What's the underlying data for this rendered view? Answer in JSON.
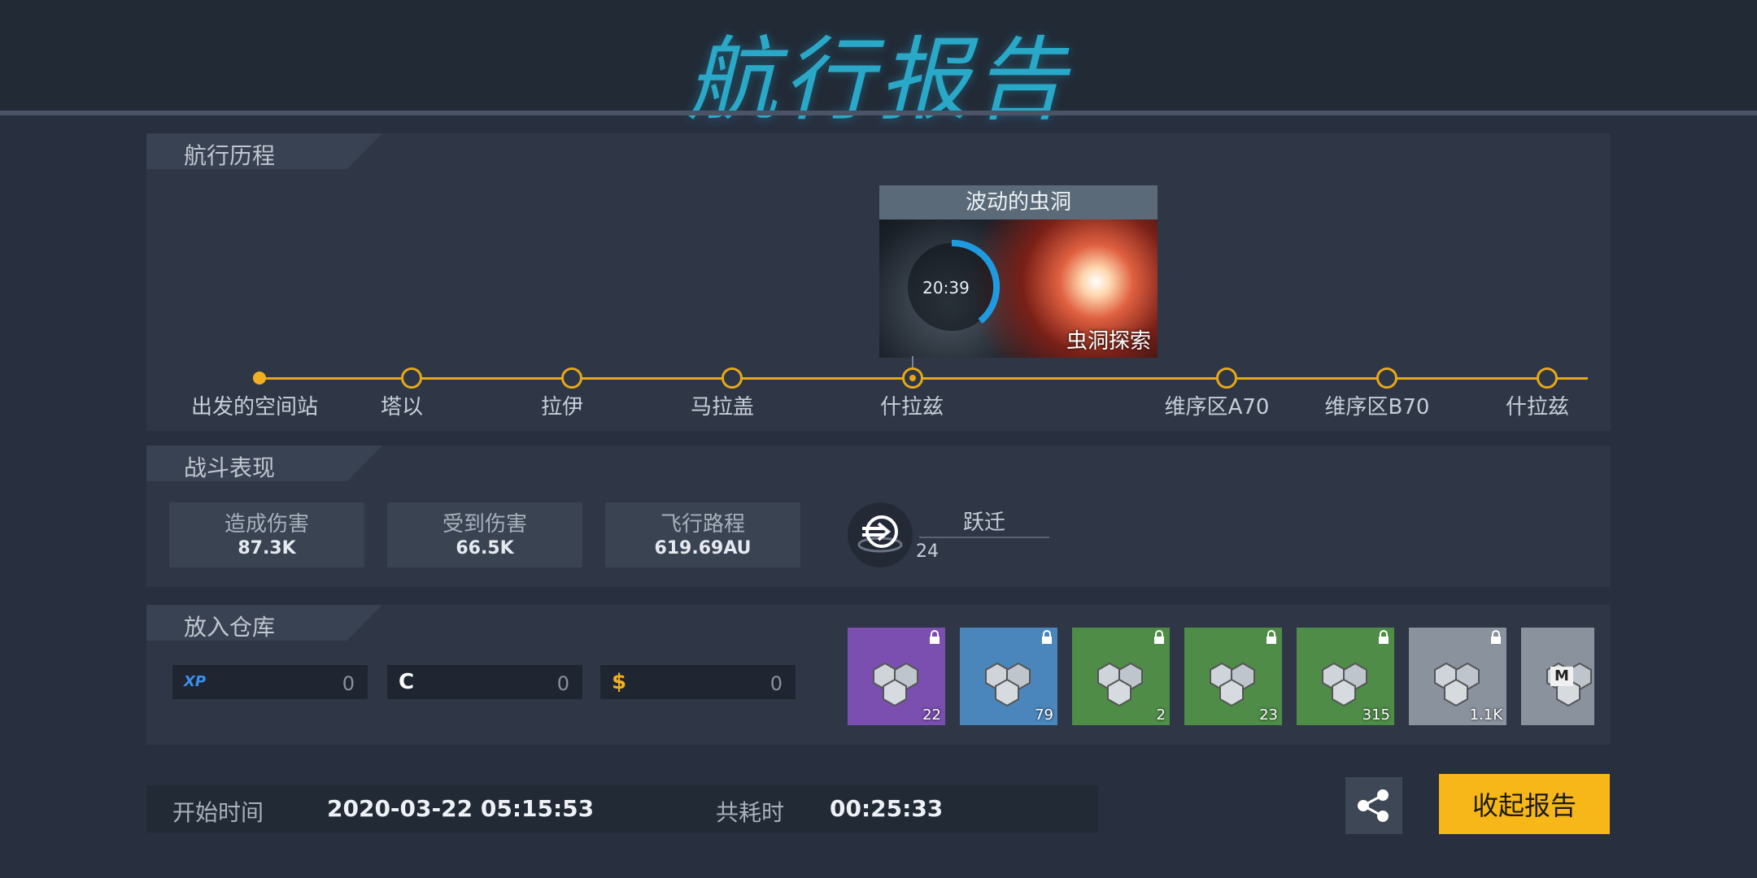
{
  "header": {
    "title": "航行报告"
  },
  "voyage": {
    "section_title": "航行历程",
    "nodes": [
      {
        "label": "出发的空间站"
      },
      {
        "label": "塔以"
      },
      {
        "label": "拉伊"
      },
      {
        "label": "马拉盖"
      },
      {
        "label": "什拉兹"
      },
      {
        "label": "维序区A70"
      },
      {
        "label": "维序区B70"
      },
      {
        "label": "什拉兹"
      }
    ],
    "event": {
      "title": "波动的虫洞",
      "timer": "20:39",
      "subtitle": "虫洞探索"
    }
  },
  "combat": {
    "section_title": "战斗表现",
    "stats": [
      {
        "label": "造成伤害",
        "value": "87.3K"
      },
      {
        "label": "受到伤害",
        "value": "66.5K"
      },
      {
        "label": "飞行路程",
        "value": "619.69AU"
      }
    ],
    "jump": {
      "label": "跃迁",
      "value": "24"
    }
  },
  "storage": {
    "section_title": "放入仓库",
    "resources": [
      {
        "icon": "XP",
        "value": "0",
        "color": "#3a8fe8"
      },
      {
        "icon": "C",
        "value": "0",
        "color": "#ffffff"
      },
      {
        "icon": "$",
        "value": "0",
        "color": "#f0b020"
      }
    ],
    "items": [
      {
        "count": "22",
        "bg": "#7a4fb0"
      },
      {
        "count": "79",
        "bg": "#4a86bc"
      },
      {
        "count": "2",
        "bg": "#4e8c48"
      },
      {
        "count": "23",
        "bg": "#4e8c48"
      },
      {
        "count": "315",
        "bg": "#4e8c48"
      },
      {
        "count": "1.1K",
        "bg": "#8a929e"
      },
      {
        "count": "",
        "bg": "#8a929e",
        "badge": "M"
      }
    ]
  },
  "footer": {
    "start_label": "开始时间",
    "start_value": "2020-03-22 05:15:53",
    "elapsed_label": "共耗时",
    "elapsed_value": "00:25:33",
    "collect_button": "收起报告"
  }
}
